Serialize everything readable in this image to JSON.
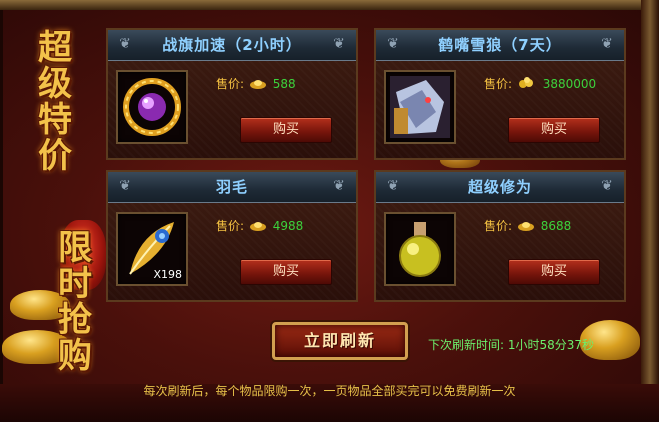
{
  "promo": {
    "line1": [
      "超",
      "级",
      "特",
      "价"
    ],
    "line2": [
      "限",
      "时",
      "抢",
      "购"
    ]
  },
  "items": [
    {
      "title": "战旗加速（2小时）",
      "price_label": "售价:",
      "currency": "yuanbao-ingot",
      "price": "588",
      "buy_label": "购买",
      "icon": "purple-gem-amulet-icon",
      "quantity": ""
    },
    {
      "title": "鹤嘴雪狼（7天）",
      "price_label": "售价:",
      "currency": "gold-coins",
      "price": "3880000",
      "buy_label": "购买",
      "icon": "snow-wolf-mount-icon",
      "quantity": ""
    },
    {
      "title": "羽毛",
      "price_label": "售价:",
      "currency": "yuanbao-ingot",
      "price": "4988",
      "buy_label": "购买",
      "icon": "golden-feather-icon",
      "quantity": "X198"
    },
    {
      "title": "超级修为",
      "price_label": "售价:",
      "currency": "yuanbao-ingot",
      "price": "8688",
      "buy_label": "购买",
      "icon": "potion-flask-icon",
      "quantity": ""
    }
  ],
  "refresh": {
    "button_label": "立即刷新",
    "next_label": "下次刷新时间:",
    "next_time": "1小时58分37秒"
  },
  "footer_note": "每次刷新后，每个物品限购一次，一页物品全部买完可以免费刷新一次",
  "colors": {
    "title_blue": "#8fd0ff",
    "price_green": "#3cd23c",
    "label_gold": "#f5c242"
  }
}
